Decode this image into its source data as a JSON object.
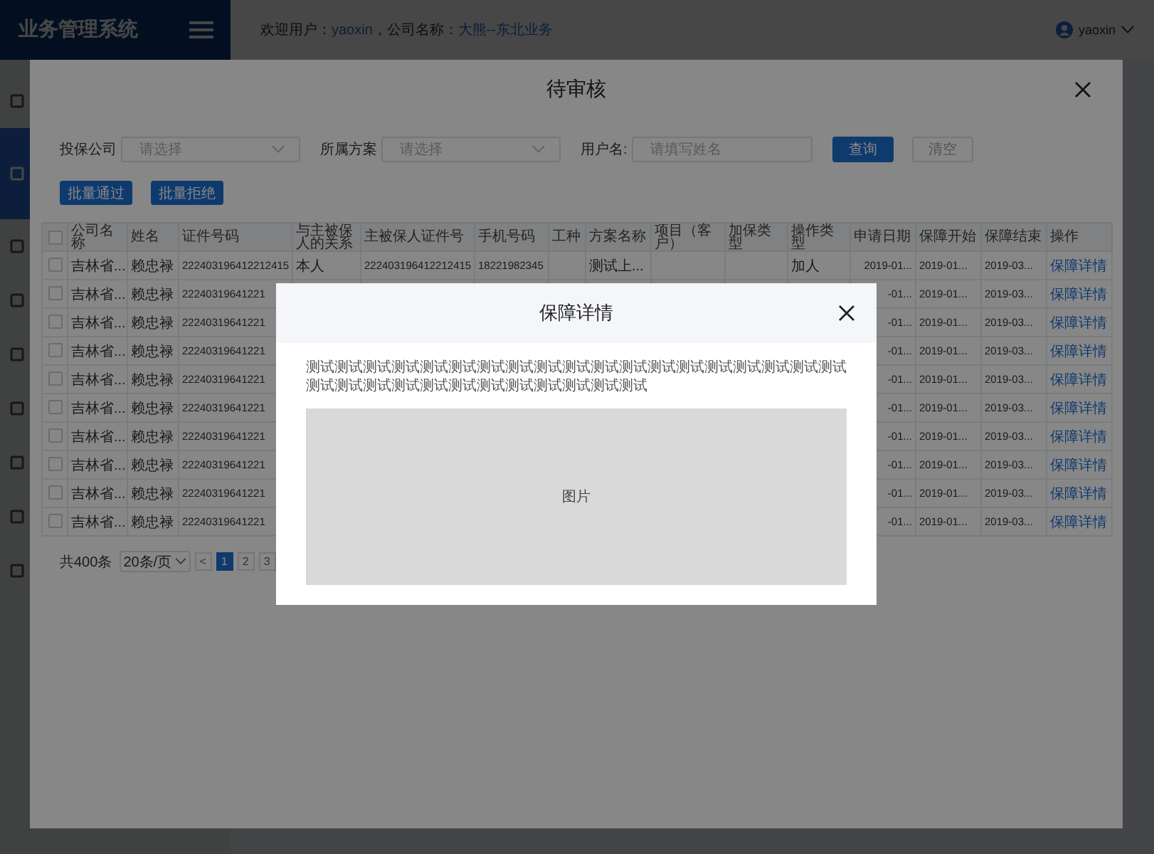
{
  "header": {
    "logo": "业务管理系统",
    "welcome_label": "欢迎用户：",
    "user": "yaoxin",
    "company_label": "，公司名称：",
    "company": "大熊--东北业务",
    "account": "yaoxin"
  },
  "sidebar": {
    "items": [
      {
        "selected": false
      },
      {
        "selected": true
      },
      {
        "selected": false
      },
      {
        "selected": false
      },
      {
        "selected": false
      },
      {
        "selected": false
      },
      {
        "selected": false
      },
      {
        "selected": false
      },
      {
        "selected": false
      }
    ]
  },
  "review_dialog": {
    "title": "待审核",
    "filters": [
      {
        "label": "投保公司",
        "kind": "select",
        "placeholder": "请选择"
      },
      {
        "label": "所属方案",
        "kind": "select",
        "placeholder": "请选择"
      },
      {
        "label": "用户名:",
        "kind": "input",
        "placeholder": "请填写姓名"
      }
    ],
    "query_button": "查询",
    "clear_button": "清空",
    "batch_buttons": [
      "批量通过",
      "批量拒绝"
    ],
    "table": {
      "select_all_checked": false,
      "columns": [
        {
          "label": "公司名称",
          "kind": "text"
        },
        {
          "label": "姓名",
          "kind": "text"
        },
        {
          "label": "证件号码",
          "kind": "number"
        },
        {
          "label": "与主被保人的关系",
          "kind": "text"
        },
        {
          "label": "主被保人证件号",
          "kind": "number"
        },
        {
          "label": "手机号码",
          "kind": "number"
        },
        {
          "label": "工种",
          "kind": "text"
        },
        {
          "label": "方案名称",
          "kind": "text"
        },
        {
          "label": "项目（客户）",
          "kind": "text"
        },
        {
          "label": "加保类型",
          "kind": "text"
        },
        {
          "label": "操作类型",
          "kind": "text"
        },
        {
          "label": "申请日期",
          "kind": "date"
        },
        {
          "label": "保障开始",
          "kind": "number"
        },
        {
          "label": "保障结束",
          "kind": "number"
        },
        {
          "label": "操作",
          "kind": "link"
        }
      ],
      "rows": [
        {
          "checked": false,
          "cells": [
            "吉林省...",
            "赖忠禄",
            "222403196412212415",
            "本人",
            "222403196412212415",
            "18221982345",
            null,
            "测试上...",
            null,
            null,
            "加人",
            "2019-01...",
            "2019-01...",
            "2019-03...",
            "保障详情"
          ]
        },
        {
          "checked": false,
          "cells": [
            "吉林省...",
            "赖忠禄",
            "22240319641221",
            null,
            null,
            null,
            null,
            null,
            null,
            null,
            null,
            "-01...",
            "2019-01...",
            "2019-03...",
            "保障详情"
          ]
        },
        {
          "checked": false,
          "cells": [
            "吉林省...",
            "赖忠禄",
            "22240319641221",
            null,
            null,
            null,
            null,
            null,
            null,
            null,
            null,
            "-01...",
            "2019-01...",
            "2019-03...",
            "保障详情"
          ]
        },
        {
          "checked": false,
          "cells": [
            "吉林省...",
            "赖忠禄",
            "22240319641221",
            null,
            null,
            null,
            null,
            null,
            null,
            null,
            null,
            "-01...",
            "2019-01...",
            "2019-03...",
            "保障详情"
          ]
        },
        {
          "checked": false,
          "cells": [
            "吉林省...",
            "赖忠禄",
            "22240319641221",
            null,
            null,
            null,
            null,
            null,
            null,
            null,
            null,
            "-01...",
            "2019-01...",
            "2019-03...",
            "保障详情"
          ]
        },
        {
          "checked": false,
          "cells": [
            "吉林省...",
            "赖忠禄",
            "22240319641221",
            null,
            null,
            null,
            null,
            null,
            null,
            null,
            null,
            "-01...",
            "2019-01...",
            "2019-03...",
            "保障详情"
          ]
        },
        {
          "checked": false,
          "cells": [
            "吉林省...",
            "赖忠禄",
            "22240319641221",
            null,
            null,
            null,
            null,
            null,
            null,
            null,
            null,
            "-01...",
            "2019-01...",
            "2019-03...",
            "保障详情"
          ]
        },
        {
          "checked": false,
          "cells": [
            "吉林省...",
            "赖忠禄",
            "22240319641221",
            null,
            null,
            null,
            null,
            null,
            null,
            null,
            null,
            "-01...",
            "2019-01...",
            "2019-03...",
            "保障详情"
          ]
        },
        {
          "checked": false,
          "cells": [
            "吉林省...",
            "赖忠禄",
            "22240319641221",
            null,
            null,
            null,
            null,
            null,
            null,
            null,
            null,
            "-01...",
            "2019-01...",
            "2019-03...",
            "保障详情"
          ]
        },
        {
          "checked": false,
          "cells": [
            "吉林省...",
            "赖忠禄",
            "22240319641221",
            null,
            null,
            null,
            null,
            null,
            null,
            null,
            null,
            "-01...",
            "2019-01...",
            "2019-03...",
            "保障详情"
          ]
        }
      ]
    },
    "pagination": {
      "total": "共400条",
      "page_size": "20条/页",
      "prev": "<",
      "pages": [
        {
          "label": "1",
          "selected": true
        },
        {
          "label": "2",
          "selected": false
        },
        {
          "label": "3",
          "selected": false
        }
      ]
    }
  },
  "detail_dialog": {
    "title": "保障详情",
    "text": "测试测试测试测试测试测试测试测试测试测试测试测试测试测试测试测试测试测试测试测试测试测试测试测试测试测试测试测试测试测试测试",
    "image_label": "图片"
  }
}
